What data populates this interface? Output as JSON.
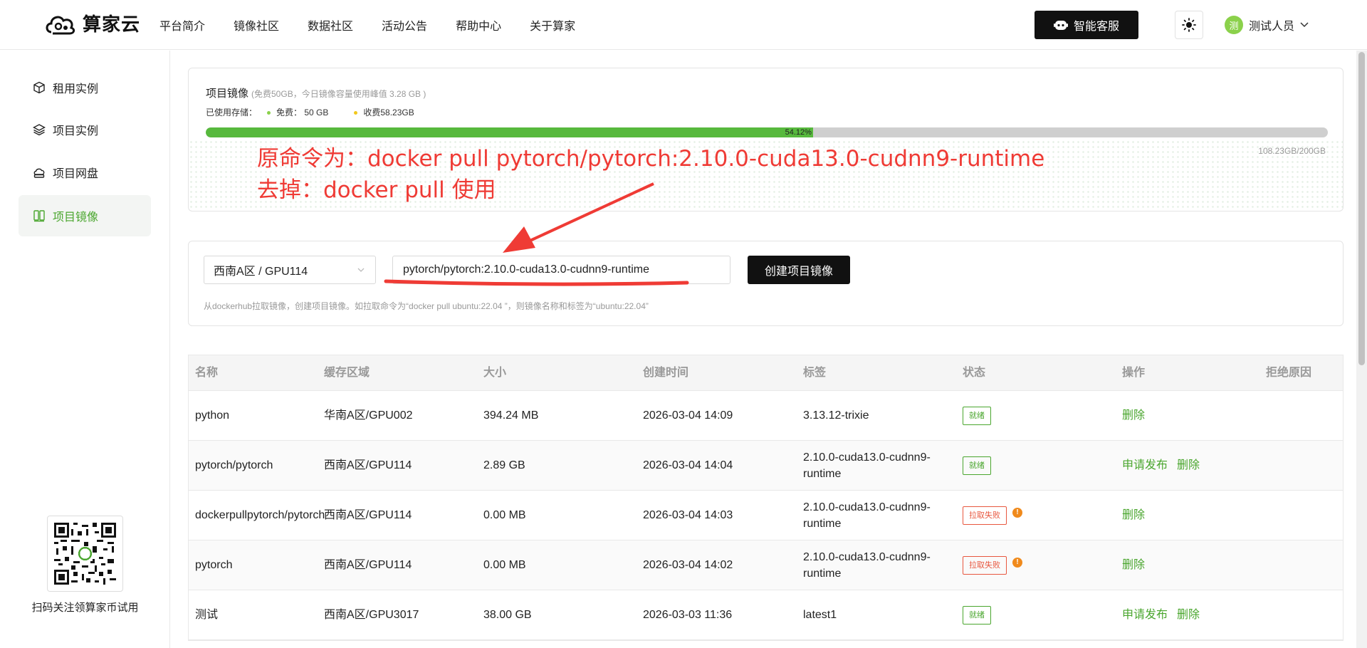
{
  "header": {
    "logo_text": "算家云",
    "nav": [
      "平台简介",
      "镜像社区",
      "数据社区",
      "活动公告",
      "帮助中心",
      "关于算家"
    ],
    "ai_service_label": "智能客服",
    "user_avatar_char": "测",
    "user_name": "测试人员"
  },
  "sidebar": {
    "items": [
      {
        "label": "租用实例",
        "icon": "cube-icon",
        "active": false
      },
      {
        "label": "项目实例",
        "icon": "layers-icon",
        "active": false
      },
      {
        "label": "项目网盘",
        "icon": "cloud-disk-icon",
        "active": false
      },
      {
        "label": "项目镜像",
        "icon": "image-icon",
        "active": true
      }
    ],
    "qr_caption": "扫码关注领算家币试用"
  },
  "storage": {
    "title": "项目镜像",
    "subtitle": "(免费50GB，今日镜像容量使用峰值 3.28 GB )",
    "used_label": "已使用存储：",
    "free_label": "免费：  50 GB",
    "paid_label": "收费58.23GB",
    "percent_label": "54.12%",
    "percent_value": 54.12,
    "total_label": "108.23GB/200GB",
    "colors": {
      "free_dot": "#8bd14b",
      "paid_dot": "#f2c81c",
      "bar": "#57b93d"
    }
  },
  "create": {
    "region_value": "西南A区 / GPU114",
    "image_value": "pytorch/pytorch:2.10.0-cuda13.0-cudnn9-runtime",
    "button_label": "创建项目镜像",
    "hint": "从dockerhub拉取镜像，创建项目镜像。如拉取命令为“docker pull ubuntu:22.04 ”，则镜像名称和标签为“ubuntu:22.04”"
  },
  "annotation": {
    "line1": "原命令为：docker pull pytorch/pytorch:2.10.0-cuda13.0-cudnn9-runtime",
    "line2": "去掉：docker pull 使用",
    "color": "#ef3b35"
  },
  "table": {
    "headers": [
      "名称",
      "缓存区域",
      "大小",
      "创建时间",
      "标签",
      "状态",
      "操作",
      "拒绝原因"
    ],
    "rows": [
      {
        "name": "python",
        "region": "华南A区/GPU002",
        "size": "394.24 MB",
        "created": "2026-03-04 14:09",
        "tag": "3.13.12-trixie",
        "status": "就绪",
        "status_type": "ok",
        "actions": [
          "删除"
        ]
      },
      {
        "name": "pytorch/pytorch",
        "region": "西南A区/GPU114",
        "size": "2.89 GB",
        "created": "2026-03-04 14:04",
        "tag": "2.10.0-cuda13.0-cudnn9-runtime",
        "status": "就绪",
        "status_type": "ok",
        "actions": [
          "申请发布",
          "删除"
        ]
      },
      {
        "name": "dockerpullpytorch/pytorch",
        "region": "西南A区/GPU114",
        "size": "0.00 MB",
        "created": "2026-03-04 14:03",
        "tag": "2.10.0-cuda13.0-cudnn9-runtime",
        "status": "拉取失败",
        "status_type": "fail",
        "actions": [
          "删除"
        ]
      },
      {
        "name": "pytorch",
        "region": "西南A区/GPU114",
        "size": "0.00 MB",
        "created": "2026-03-04 14:02",
        "tag": "2.10.0-cuda13.0-cudnn9-runtime",
        "status": "拉取失败",
        "status_type": "fail",
        "actions": [
          "删除"
        ]
      },
      {
        "name": "测试",
        "region": "西南A区/GPU3017",
        "size": "38.00 GB",
        "created": "2026-03-03 11:36",
        "tag": "latest1",
        "status": "就绪",
        "status_type": "ok",
        "actions": [
          "申请发布",
          "删除"
        ]
      }
    ]
  }
}
